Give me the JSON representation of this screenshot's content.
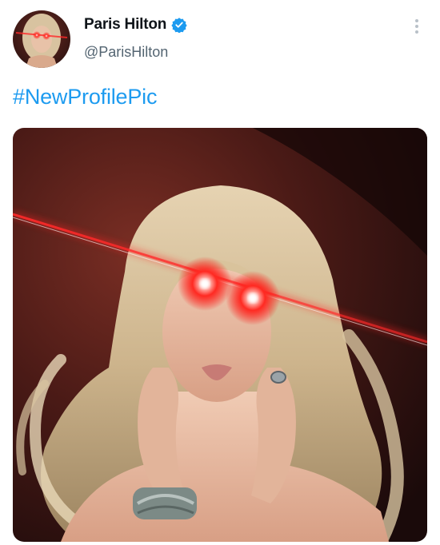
{
  "user": {
    "display_name": "Paris Hilton",
    "handle": "@ParisHilton",
    "verified": true
  },
  "tweet": {
    "text": "#NewProfilePic"
  },
  "icons": {
    "verified": "verified-badge-icon",
    "more": "more-options-icon"
  },
  "colors": {
    "link": "#1d9bf0",
    "name": "#0f1419",
    "handle": "#536471",
    "laser": "#ff2020"
  }
}
